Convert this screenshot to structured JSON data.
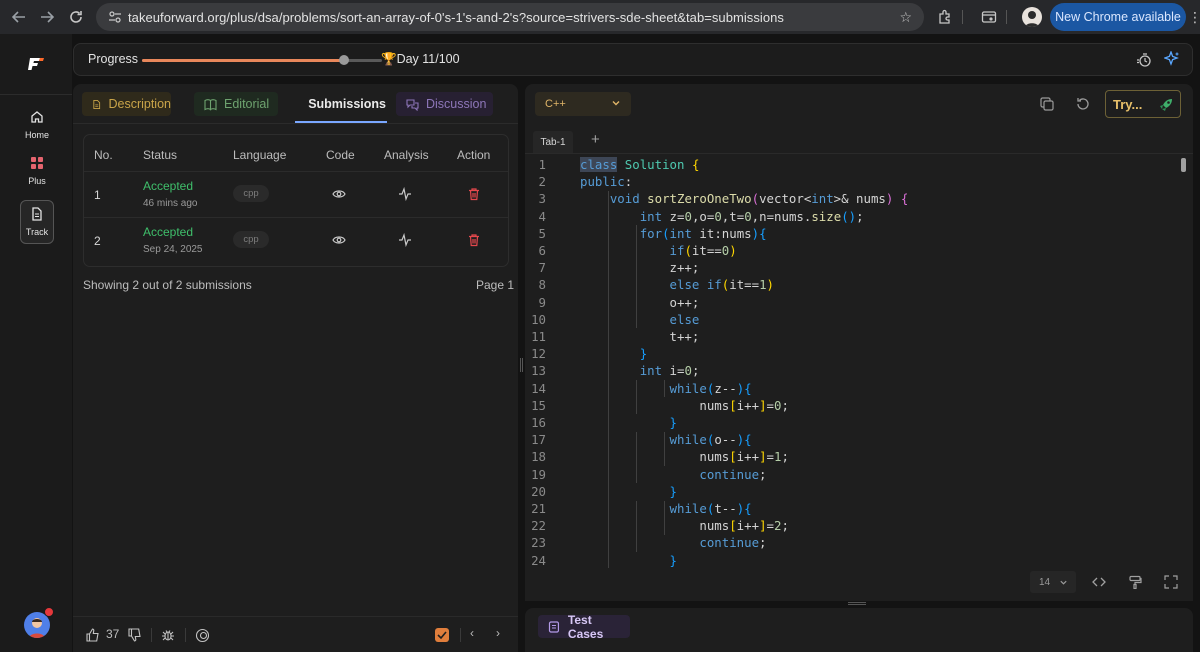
{
  "browser": {
    "url": "takeuforward.org/plus/dsa/problems/sort-an-array-of-0's-1's-and-2's?source=strivers-sde-sheet&tab=submissions",
    "new_chrome_label": "New Chrome available"
  },
  "rail": {
    "logo": "F",
    "items": [
      {
        "label": "Home",
        "icon": "home-icon"
      },
      {
        "label": "Plus",
        "icon": "grid-icon"
      },
      {
        "label": "Track",
        "icon": "document-icon",
        "active": true
      }
    ]
  },
  "progress": {
    "label": "Progress",
    "fraction": 0.84,
    "day_text": "Day 11/100",
    "accent": "#e8875b"
  },
  "tabs": {
    "description": "Description",
    "editorial": "Editorial",
    "submissions": "Submissions",
    "discussion": "Discussion"
  },
  "submissions": {
    "headers": [
      "No.",
      "Status",
      "Language",
      "Code",
      "Analysis",
      "Action"
    ],
    "rows": [
      {
        "no": "1",
        "status": "Accepted",
        "when": "46 mins ago",
        "language": "cpp"
      },
      {
        "no": "2",
        "status": "Accepted",
        "when": "Sep 24, 2025",
        "language": "cpp"
      }
    ],
    "showing_text": "Showing 2 out of 2 submissions",
    "page_text": "Page 1",
    "status_color": "#3fbf6b"
  },
  "bottom": {
    "likes": "37"
  },
  "editor": {
    "language": "C++",
    "try_label": "Try...",
    "tab_label": "Tab-1",
    "font_size": "14",
    "test_cases_label": "Test Cases",
    "line_numbers": [
      "1",
      "2",
      "3",
      "4",
      "5",
      "6",
      "7",
      "8",
      "9",
      "10",
      "11",
      "12",
      "13",
      "14",
      "15",
      "16",
      "17",
      "18",
      "19",
      "20",
      "21",
      "22",
      "23",
      "24"
    ]
  }
}
